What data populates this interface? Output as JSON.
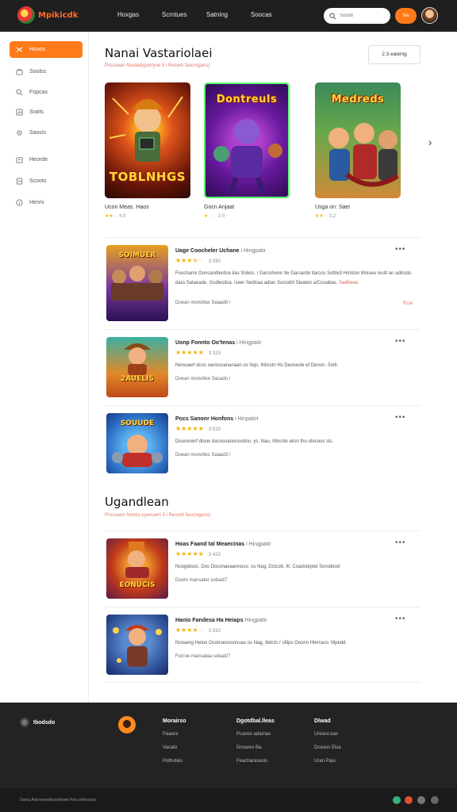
{
  "header": {
    "logo_text": "Mpikicdk",
    "nav": [
      "Hoxgas",
      "Scrntues",
      "Satning",
      "Soocas"
    ],
    "search_placeholder": "Soooh",
    "signin_label": "Iso"
  },
  "sidebar": {
    "items": [
      {
        "label": "Hooos",
        "icon": "gamepad-icon",
        "active": true
      },
      {
        "label": "Soolss",
        "icon": "bag-icon"
      },
      {
        "label": "Fopcas",
        "icon": "search-icon"
      },
      {
        "label": "Sraits",
        "icon": "chart-icon"
      },
      {
        "label": "Saocis",
        "icon": "gear-icon"
      },
      {
        "label": "Heorde",
        "icon": "folder-icon"
      },
      {
        "label": "Scoots",
        "icon": "document-icon"
      },
      {
        "label": "Henni",
        "icon": "info-icon"
      }
    ]
  },
  "featured": {
    "title": "Nanai Vastariolaei",
    "subtitle": "Procoean Nouladyponlyne 5 i Resorb fascrogans)",
    "view_all": "2.3 eaixing",
    "cards": [
      {
        "cover_text": "TOBLNHGS",
        "name": "Ucon Meas. Haos",
        "rating_value": 2.5,
        "rating_text": "4.9"
      },
      {
        "cover_text": "Dontreuls",
        "name": "Gocn Anjaat",
        "rating_value": 1.5,
        "rating_text": "2.5"
      },
      {
        "cover_text": "Medreds",
        "name": "Usga on: Saei",
        "rating_value": 2.5,
        "rating_text": "3.2"
      }
    ]
  },
  "list1": [
    {
      "title": "Uage Coocheler Uchane",
      "tag": "i Hingpatir",
      "rating_value": 3.5,
      "count": "3 330",
      "desc": "Foocharre Ooncandlerdoo ilas Sobos. i Sarcohorer Ile Garsarde tlarcos Sofde3 Hotslon Moiseo Iesitl an adirodo dara Sataeade. Gcdlesiloa. Iseer Sedtraa adian Surcaltrl Sieaten a/Cooabas.",
      "desc_hl": "Sadheee.",
      "meta": "Doean monoltas Saaad9 /",
      "more_link": "Rcai",
      "thumb_text": "SOIMUER"
    },
    {
      "title": "Uonp Fonnto Oo'tenas",
      "tag": "i Hingpatir",
      "rating_value": 5,
      "count": "3 323",
      "desc": "Nenoaerf dcos oanosoananaan os Nqs, Ihbcstn Hs Deosesle ef Denon. Sollt.",
      "desc_hl": "",
      "meta": "Doean monoltee Sacado /",
      "more_link": "",
      "thumb_text": "2AUELIS"
    },
    {
      "title": "Pocs Sanonr Honfons",
      "tag": "i Hinpatirt",
      "rating_value": 5,
      "count": "3 523",
      "desc": "Douneoerf dlooo dacosoanonosdoo. ys. Nau, Ihbcnte ailsn tho ofesoos sls.",
      "desc_hl": "",
      "meta": "Doean monoltes Saaad3 /",
      "more_link": "",
      "thumb_text": "SOUUDE"
    }
  ],
  "section2": {
    "title": "Ugandlean",
    "subtitle": "Procoean Nonbs oyeeuetn 5 i Resorb fascrogans)"
  },
  "list2": [
    {
      "title": "Hoas Faand tal Meaecinas",
      "tag": "i Hingpatir",
      "rating_value": 5,
      "count": "3 423",
      "desc": "Noogtdooc. Dos Doconaeaannoos: os Nag, Dctcob. Ilt. Coadsteptel Sorodeod",
      "meta": "Doom mansater sobad/7",
      "thumb_text": "EONUCIS"
    },
    {
      "title": "Hanio Fandesa Ha Heiaps",
      "tag": "Hingpatir",
      "rating_value": 4,
      "count": "3 310",
      "desc": "Nooaerg Heioo Oconoecnonnuas os Nag, Ibdcto r sfiips Ooonn Hlerraoo. Mpedd.",
      "meta": "Foo'oe mansataa sobad/7",
      "thumb_text": ""
    }
  ],
  "footer": {
    "brand": "Ibodsdo",
    "columns": [
      {
        "heading": "Morairso",
        "links": [
          "Paaora",
          "Vacato",
          "Pothuties"
        ]
      },
      {
        "heading": "Dgotdbal.lleas",
        "links": [
          "Pcaoos adarnas",
          "Drosees Ba.",
          "Feacharaseuis"
        ]
      },
      {
        "heading": "Dlwad",
        "links": [
          "Urioesl.eas",
          "Dceous Elsa",
          "Uran Paiu"
        ]
      }
    ],
    "copyright": "Dana Adcooeadsoedooie frou otlmoavs"
  },
  "colors": {
    "accent": "#ff7a1a",
    "header_bg": "#1f1f1f",
    "footer_bg": "#232323",
    "star": "#f5b400",
    "subtitle": "#e07a6a"
  }
}
